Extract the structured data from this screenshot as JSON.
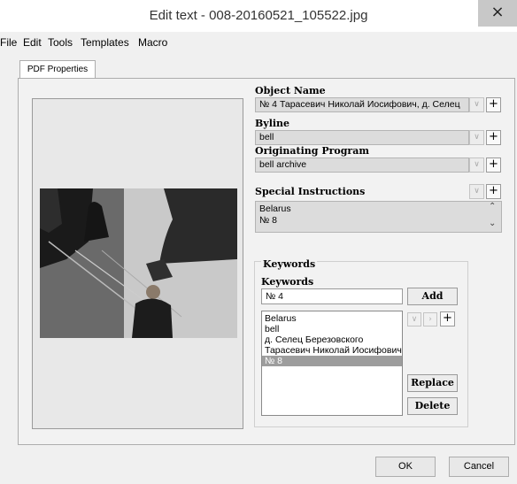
{
  "window": {
    "title": "Edit text - 008-20160521_105522.jpg",
    "close_glyph": "×"
  },
  "menu": [
    "File",
    "Edit",
    "Tools",
    "Templates",
    "Macro"
  ],
  "tabs": [
    {
      "label": "PDF Properties",
      "active": true
    }
  ],
  "fields": {
    "object_name": {
      "label": "Object Name",
      "value": "№ 4 Тарасевич Николай Иосифович, д. Селец"
    },
    "byline": {
      "label": "Byline",
      "value": "bell"
    },
    "originating_program": {
      "label": "Originating Program",
      "value": "bell archive"
    },
    "special_instructions": {
      "label": "Special Instructions",
      "lines": [
        "Belarus",
        "№ 8"
      ]
    }
  },
  "keywords": {
    "group_title": "Keywords",
    "label": "Keywords",
    "input_value": "№ 4",
    "add_label": "Add",
    "replace_label": "Replace",
    "delete_label": "Delete",
    "items": [
      "Belarus",
      "bell",
      "д. Селец Березовского",
      "Тарасевич Николай Иосифович",
      "№ 8"
    ],
    "selected_index": 4
  },
  "footer": {
    "ok_label": "OK",
    "cancel_label": "Cancel"
  },
  "colors": {
    "field_bg": "#dcdcdc",
    "selection": "#9d9d9d"
  }
}
